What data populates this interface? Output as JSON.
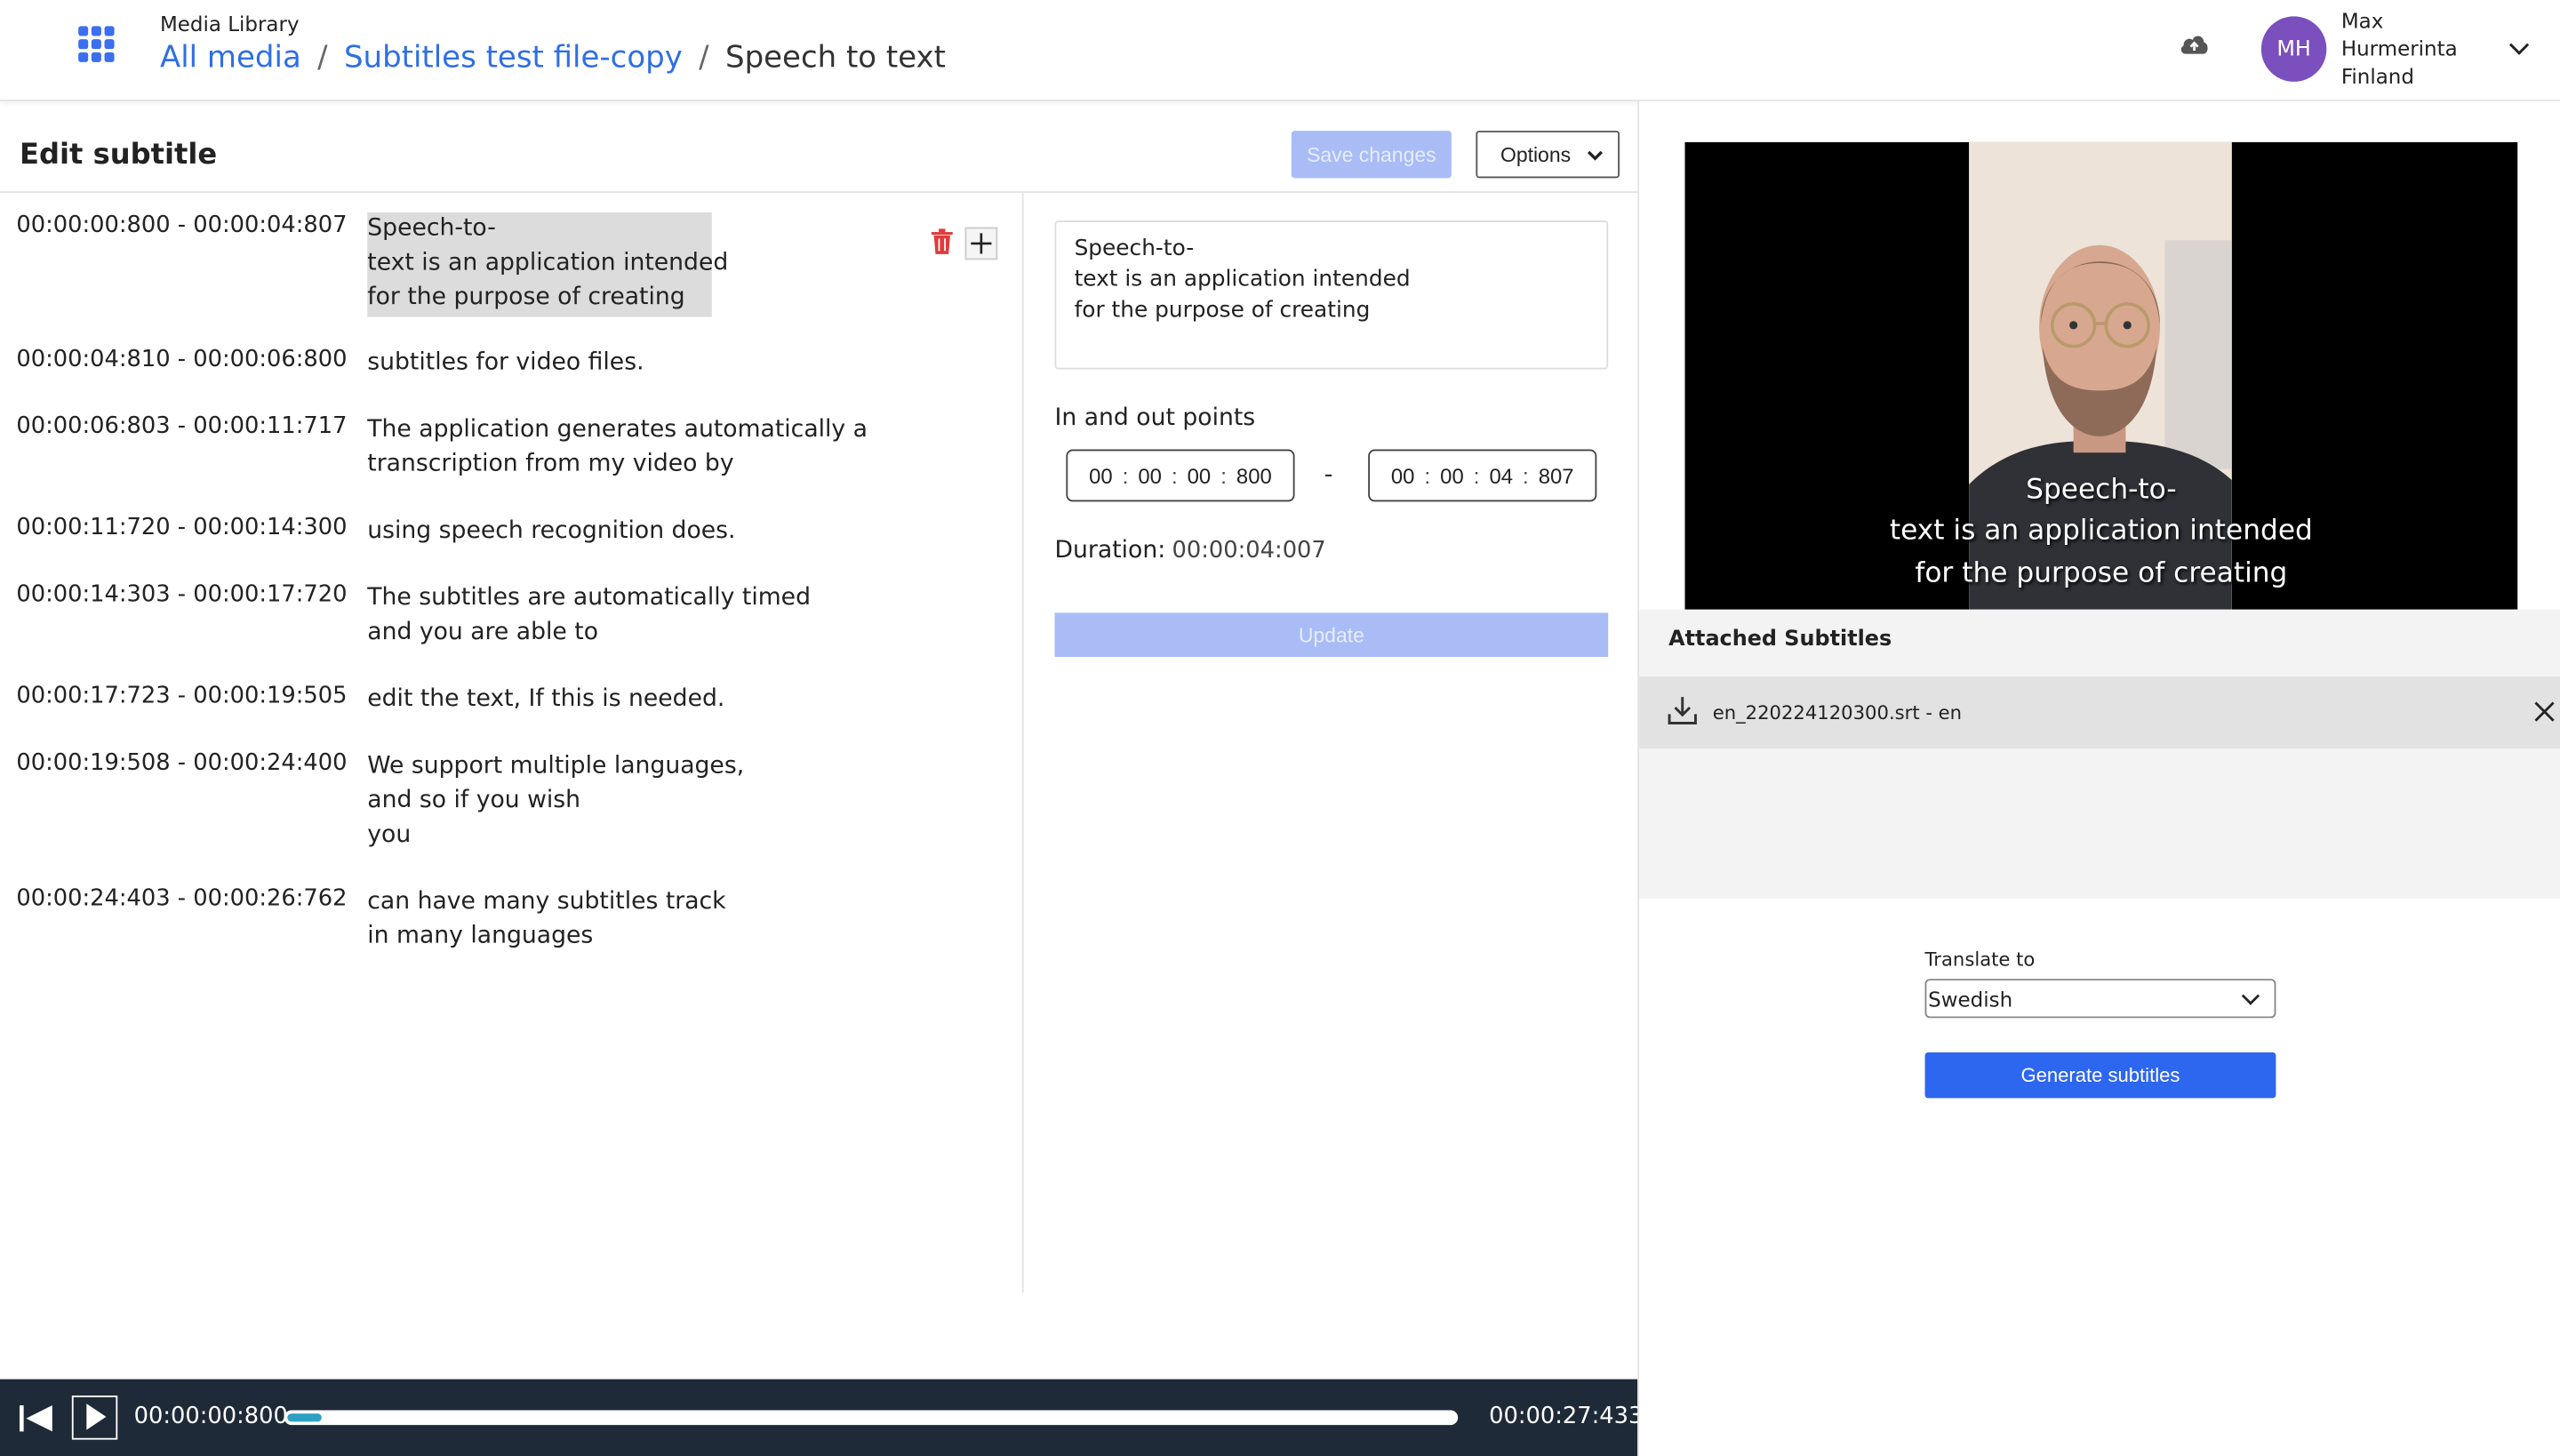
{
  "header": {
    "app_name": "Media Library",
    "breadcrumb": [
      {
        "label": "All media"
      },
      {
        "label": "Subtitles test file-copy"
      },
      {
        "label": "Speech to text"
      }
    ],
    "user": {
      "initials": "MH",
      "name_line1": "Max",
      "name_line2": "Hurmerinta",
      "name_line3": "Finland",
      "avatar_color": "#7b4fbd"
    }
  },
  "editor": {
    "title": "Edit subtitle",
    "save_label": "Save changes",
    "options_label": "Options",
    "subtitles": [
      {
        "time": "00:00:00:800 - 00:00:04:807",
        "text": "Speech-to-\ntext is an application intended\nfor the purpose of creating",
        "selected": true
      },
      {
        "time": "00:00:04:810 - 00:00:06:800",
        "text": "subtitles for video files."
      },
      {
        "time": "00:00:06:803 - 00:00:11:717",
        "text": "The application generates automatically a\ntranscription from my video by"
      },
      {
        "time": "00:00:11:720 - 00:00:14:300",
        "text": "using speech recognition does."
      },
      {
        "time": "00:00:14:303 - 00:00:17:720",
        "text": "The subtitles are automatically timed\nand you are able to"
      },
      {
        "time": "00:00:17:723 - 00:00:19:505",
        "text": "edit the text, If this is needed."
      },
      {
        "time": "00:00:19:508 - 00:00:24:400",
        "text": "We support multiple languages,\nand so if you wish\nyou"
      },
      {
        "time": "00:00:24:403 - 00:00:26:762",
        "text": "can have many subtitles track\nin many languages"
      }
    ]
  },
  "form": {
    "text": "Speech-to-\ntext is an application intended\nfor the purpose of creating",
    "inout_label": "In and out points",
    "in_point": {
      "h": "00",
      "m": "00",
      "s": "00",
      "ms": "800"
    },
    "out_point": {
      "h": "00",
      "m": "00",
      "s": "04",
      "ms": "807"
    },
    "dash": "-",
    "duration_label": "Duration:",
    "duration_value": "00:00:04:007",
    "update_label": "Update"
  },
  "player": {
    "current_time": "00:00:00:800",
    "total_time": "00:00:27:433",
    "progress": 0.029
  },
  "right": {
    "video_caption": "Speech-to-\ntext is an application intended\nfor the purpose of creating",
    "attached_title": "Attached Subtitles",
    "attached_files": [
      {
        "name": "en_220224120300.srt - en"
      }
    ],
    "translate_label": "Translate to",
    "translate_value": "Swedish",
    "generate_label": "Generate subtitles"
  },
  "colors": {
    "accent": "#2d66ef",
    "link": "#2f6fe4",
    "disabled": "#a9bcf5",
    "player_bg": "#1f2a38",
    "progress": "#2ea0c2",
    "trash": "#e03b3b"
  }
}
